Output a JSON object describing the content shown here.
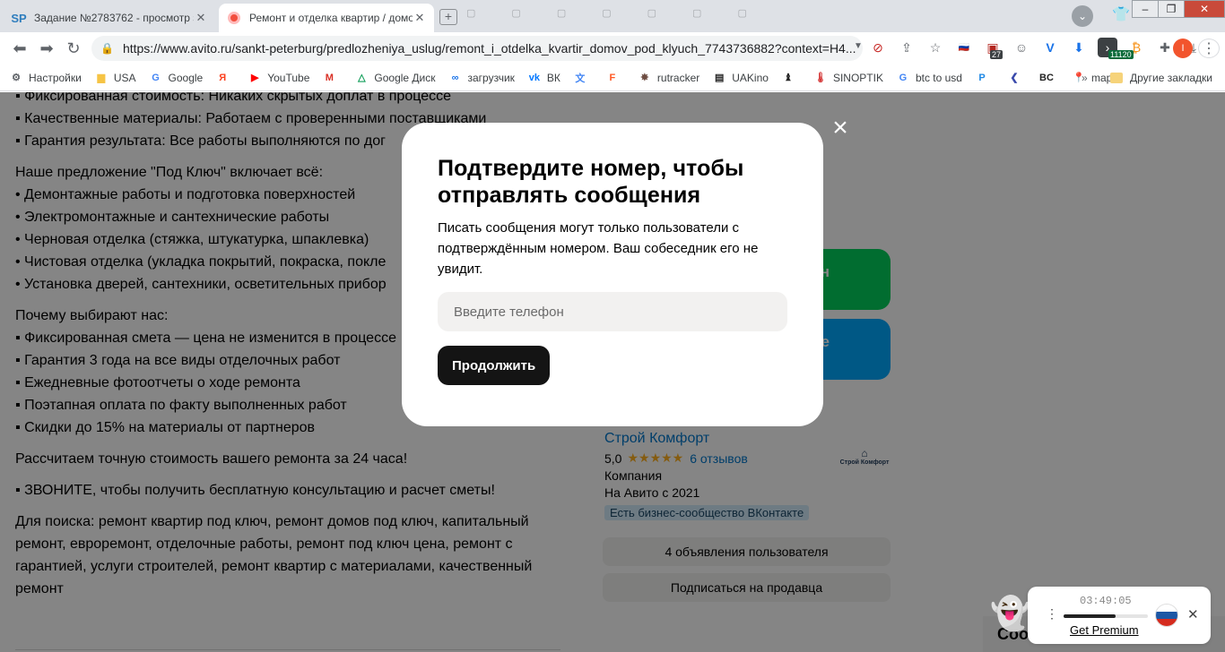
{
  "browser": {
    "tabs": [
      {
        "favicon": "SP",
        "title": "Задание №2783762 - просмотр з",
        "active": false
      },
      {
        "favicon": "avito-icon",
        "title": "Ремонт и отделка квартир / домо",
        "active": true
      }
    ],
    "address": "https://www.avito.ru/sankt-peterburg/predlozheniya_uslug/remont_i_otdelka_kvartir_domov_pod_klyuch_7743736882?context=H4...",
    "ext_badge_count": "27",
    "ext_price": "11120",
    "profile_initial": "I",
    "bookmarks": [
      {
        "icon": "gear-icon",
        "label": "Настройки"
      },
      {
        "icon": "folder-icon",
        "label": "USA"
      },
      {
        "icon": "google-icon",
        "label": "Google"
      },
      {
        "icon": "yandex-icon",
        "label": ""
      },
      {
        "icon": "youtube-icon",
        "label": "YouTube"
      },
      {
        "icon": "gmail-icon",
        "label": ""
      },
      {
        "icon": "drive-icon",
        "label": "Google Диск"
      },
      {
        "icon": "loader-icon",
        "label": "загрузчик"
      },
      {
        "icon": "vk-icon",
        "label": "ВК"
      },
      {
        "icon": "translate-icon",
        "label": ""
      },
      {
        "icon": "f-icon",
        "label": ""
      },
      {
        "icon": "rutracker-icon",
        "label": "rutracker"
      },
      {
        "icon": "uakino-icon",
        "label": "UAKino"
      },
      {
        "icon": "chess-icon",
        "label": ""
      },
      {
        "icon": "thermometer-icon",
        "label": "SINOPTIK"
      },
      {
        "icon": "google-icon",
        "label": "btc to usd"
      },
      {
        "icon": "p-icon",
        "label": ""
      },
      {
        "icon": "arrow-icon",
        "label": ""
      },
      {
        "icon": "bc-icon",
        "label": ""
      },
      {
        "icon": "maps-icon",
        "label": "maps"
      }
    ],
    "more_bookmarks": "»",
    "other_bookmarks": "Другие закладки"
  },
  "description": {
    "top_lines": [
      "▪ Фиксированная стоимость: Никаких скрытых доплат в процессе",
      "▪ Качественные материалы: Работаем с проверенными поставщиками",
      "▪ Гарантия результата: Все работы выполняются по дог"
    ],
    "offer_title": "Наше предложение \"Под Ключ\" включает всё:",
    "offer_items": [
      "• Демонтажные работы и подготовка поверхностей",
      "• Электромонтажные и сантехнические работы",
      "• Черновая отделка (стяжка, штукатурка, шпаклевка)",
      "• Чистовая отделка (укладка покрытий, покраска, покле",
      "• Установка дверей, сантехники, осветительных прибор"
    ],
    "why_title": "Почему выбирают нас:",
    "why_items": [
      "▪ Фиксированная смета — цена не изменится в процессе",
      "▪ Гарантия 3 года на все виды отделочных работ",
      "▪ Ежедневные фотоотчеты о ходе ремонта",
      "▪ Поэтапная оплата по факту выполненных работ",
      "▪ Скидки до 15% на материалы от партнеров"
    ],
    "estimate": "Рассчитаем точную стоимость вашего ремонта за 24 часа!",
    "call": "▪ ЗВОНИТЕ, чтобы получить бесплатную консультацию и расчет сметы!",
    "search_terms": "Для поиска: ремонт квартир под ключ, ремонт домов под ключ, капитальный ремонт, евроремонт, отделочные работы, ремонт под ключ цена, ремонт с гарантией, услуги строителей, ремонт квартир с материалами, качественный ремонт"
  },
  "sidebar": {
    "green_button_label": "н",
    "blue_button_label": "е",
    "seller_name": "Строй Комфорт",
    "rating": "5,0",
    "stars": "★★★★★",
    "reviews": "6 отзывов",
    "seller_type": "Компания",
    "since": "На Авито с 2021",
    "vk_badge": "Есть бизнес-сообщество ВКонтакте",
    "logo_text": "Строй Комфорт",
    "ads_button": "4 объявления пользователя",
    "subscribe_button": "Подписаться на продавца",
    "bottom_heading": "Соо"
  },
  "modal": {
    "title": "Подтвердите номер, чтобы отправлять сообщения",
    "note": "Писать сообщения могут только пользователи с подтверждённым номером. Ваш собеседник его не увидит.",
    "phone_placeholder": "Введите телефон",
    "continue_label": "Продолжить",
    "close_glyph": "×"
  },
  "vpn": {
    "timer": "03:49:05",
    "progress": 0.62,
    "premium_label": "Get Premium",
    "flag_colors": [
      "#ffffff",
      "#1c57a5",
      "#d52b1e"
    ]
  },
  "colors": {
    "avito_green": "#02d15c",
    "avito_blue": "#00aaff",
    "link_blue": "#0077cc",
    "star_orange": "#ffb021",
    "modal_button": "#141414"
  }
}
